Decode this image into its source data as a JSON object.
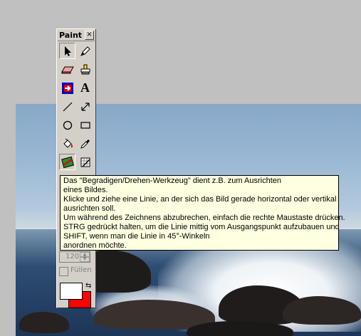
{
  "palette": {
    "title": "Paint",
    "close_glyph": "×",
    "tools": [
      {
        "name": "select-tool",
        "icon": "arrow-pointer-icon",
        "active": true
      },
      {
        "name": "pencil-tool",
        "icon": "pencil-icon"
      },
      {
        "name": "eraser-tool",
        "icon": "eraser-icon"
      },
      {
        "name": "stamp-tool",
        "icon": "stamp-icon"
      },
      {
        "name": "transform-tool",
        "icon": "transform-icon"
      },
      {
        "name": "text-tool",
        "icon": "text-a-icon",
        "glyph": "A"
      },
      {
        "name": "line-tool",
        "icon": "line-icon"
      },
      {
        "name": "arrow-tool",
        "icon": "double-arrow-icon"
      },
      {
        "name": "ellipse-tool",
        "icon": "ellipse-icon"
      },
      {
        "name": "rectangle-tool",
        "icon": "rectangle-icon"
      },
      {
        "name": "fill-tool",
        "icon": "paint-bucket-icon"
      },
      {
        "name": "eyedropper-tool",
        "icon": "eyedropper-icon"
      },
      {
        "name": "straighten-rotate-tool",
        "icon": "rotate-straighten-icon"
      },
      {
        "name": "grid-tool",
        "icon": "grid-pencil-icon"
      }
    ],
    "size_value": "120",
    "fill_label": "Füllen",
    "foreground_color": "#ffffff",
    "background_color": "#ff0000"
  },
  "tooltip": {
    "lines": [
      "Das \"Begradigen/Drehen-Werkzeug\" dient z.B. zum Ausrichten",
      "eines Bildes.",
      "Klicke und ziehe eine Linie, an der sich das Bild gerade horizontal oder vertikal",
      "ausrichten soll.",
      "Um während des Zeichnens abzubrechen, einfach die rechte Maustaste drücken.",
      "STRG gedrückt halten, um die Linie mittig vom Ausgangspunkt aufzubauen und",
      "SHIFT, wenn man die Linie in 45°-Winkeln",
      "anordnen möchte."
    ]
  }
}
